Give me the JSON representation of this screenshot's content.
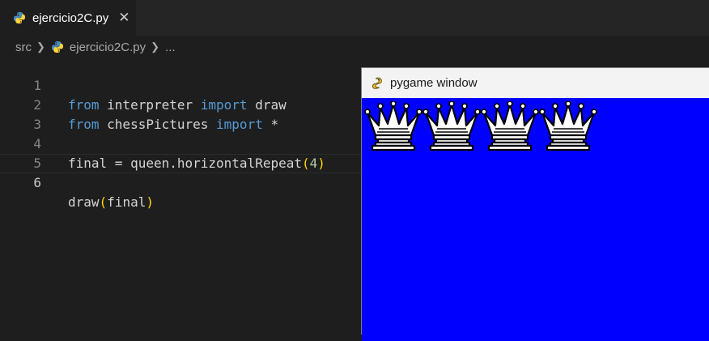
{
  "editor_tab": {
    "filename": "ejercicio2C.py",
    "close_glyph": "✕",
    "icon": "python-file-icon"
  },
  "breadcrumb": {
    "folder": "src",
    "file": "ejercicio2C.py",
    "more": "..."
  },
  "code_lines": [
    {
      "number": "1"
    },
    {
      "number": "2"
    },
    {
      "number": "3"
    },
    {
      "number": "4"
    },
    {
      "number": "5"
    },
    {
      "number": "6"
    }
  ],
  "code": {
    "l1": {
      "kw1": "from",
      "mod": " interpreter ",
      "kw2": "import",
      "name": " draw"
    },
    "l2": {
      "kw1": "from",
      "mod": " chessPictures ",
      "kw2": "import",
      "name": " *"
    },
    "l4": {
      "lhs": "final = queen.horizontalRepeat",
      "open": "(",
      "arg": "4",
      "close": ")"
    },
    "l6": {
      "fn": "draw",
      "open": "(",
      "arg": "final",
      "close": ")"
    }
  },
  "pygame_window": {
    "title": "pygame window",
    "icon": "pygame-snake-icon",
    "background": "#0000ff",
    "pieces": [
      "queen",
      "queen",
      "queen",
      "queen"
    ]
  },
  "colors": {
    "editor_bg": "#1e1e1e",
    "keyword": "#569cd6",
    "number": "#b5cea8",
    "bracket": "#ffd700"
  }
}
